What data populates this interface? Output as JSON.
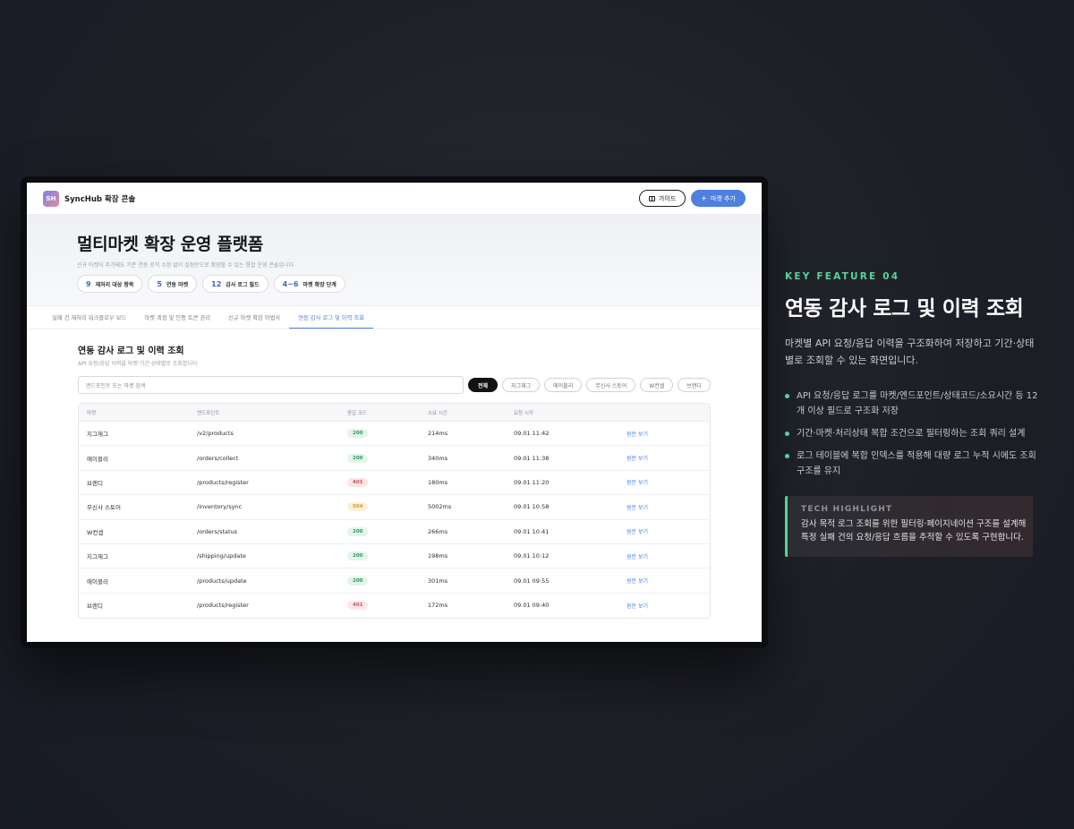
{
  "app": {
    "logo_initials": "SH",
    "brand": "SyncHub 확장 콘솔",
    "guide_label": "가이드",
    "add_market_label": "마켓 추가"
  },
  "hero": {
    "title": "멀티마켓 확장 운영 플랫폼",
    "subtitle": "신규 마켓이 추가돼도 기존 연동 로직 수정 없이 설정만으로 확장할 수 있는 통합 운영 콘솔입니다",
    "stats": [
      {
        "num": "9",
        "label": "재처리 대상 항목"
      },
      {
        "num": "5",
        "label": "연동 마켓"
      },
      {
        "num": "12",
        "label": "감사 로그 필드"
      },
      {
        "num": "4~6",
        "label": "마켓 확장 단계"
      }
    ]
  },
  "tabs": [
    {
      "label": "실패 건 재처리 워크플로우 보드"
    },
    {
      "label": "마켓 계정 및 인증 토큰 관리"
    },
    {
      "label": "신규 마켓 확장 마법사"
    },
    {
      "label": "연동 감사 로그 및 이력 조회"
    }
  ],
  "active_tab": 3,
  "section": {
    "title": "연동 감사 로그 및 이력 조회",
    "desc": "API 요청/응답 이력을 마켓·기간·상태별로 조회합니다",
    "search_placeholder": "엔드포인트 또는 마켓 검색",
    "chips": [
      "전체",
      "지그재그",
      "에이블리",
      "무신사 스토어",
      "W컨셉",
      "브랜디"
    ]
  },
  "table": {
    "headers": [
      "마켓",
      "엔드포인트",
      "응답 코드",
      "소요 시간",
      "요청 시각",
      ""
    ],
    "rows": [
      {
        "market": "지그재그",
        "endpoint": "/v2/products",
        "code": "200",
        "duration": "214ms",
        "time": "09.01 11:42",
        "action": "원문 보기"
      },
      {
        "market": "에이블리",
        "endpoint": "/orders/collect",
        "code": "200",
        "duration": "340ms",
        "time": "09.01 11:38",
        "action": "원문 보기"
      },
      {
        "market": "브랜디",
        "endpoint": "/products/register",
        "code": "401",
        "duration": "180ms",
        "time": "09.01 11:20",
        "action": "원문 보기"
      },
      {
        "market": "무신사 스토어",
        "endpoint": "/inventory/sync",
        "code": "504",
        "duration": "5002ms",
        "time": "09.01 10:58",
        "action": "원문 보기"
      },
      {
        "market": "W컨셉",
        "endpoint": "/orders/status",
        "code": "200",
        "duration": "266ms",
        "time": "09.01 10:41",
        "action": "원문 보기"
      },
      {
        "market": "지그재그",
        "endpoint": "/shipping/update",
        "code": "200",
        "duration": "198ms",
        "time": "09.01 10:12",
        "action": "원문 보기"
      },
      {
        "market": "에이블리",
        "endpoint": "/products/update",
        "code": "200",
        "duration": "301ms",
        "time": "09.01 09:55",
        "action": "원문 보기"
      },
      {
        "market": "브랜디",
        "endpoint": "/products/register",
        "code": "401",
        "duration": "172ms",
        "time": "09.01 09:40",
        "action": "원문 보기"
      }
    ]
  },
  "feature": {
    "kicker": "KEY FEATURE 04",
    "title": "연동 감사 로그 및 이력 조회",
    "desc": "마켓별 API 요청/응답 이력을 구조화하여 저장하고 기간·상태별로 조회할 수 있는 화면입니다.",
    "bullets": [
      "API 요청/응답 로그를 마켓/엔드포인트/상태코드/소요시간 등 12개 이상 필드로 구조화 저장",
      "기간·마켓·처리상태 복합 조건으로 필터링하는 조회 쿼리 설계",
      "로그 테이블에 복합 인덱스를 적용해 대량 로그 누적 시에도 조회 구조를 유지"
    ],
    "highlight_label": "TECH HIGHLIGHT",
    "highlight_text": "감사 목적 로그 조회를 위한 필터링·페이지네이션 구조를 설계해 특정 실패 건의 요청/응답 흐름을 추적할 수 있도록 구현합니다."
  },
  "colors": {
    "accent": "#4f7fe0",
    "feature_green": "#57d39a",
    "ok": "#2f9a5e",
    "auth_error": "#d05353",
    "timeout": "#d4962a"
  }
}
